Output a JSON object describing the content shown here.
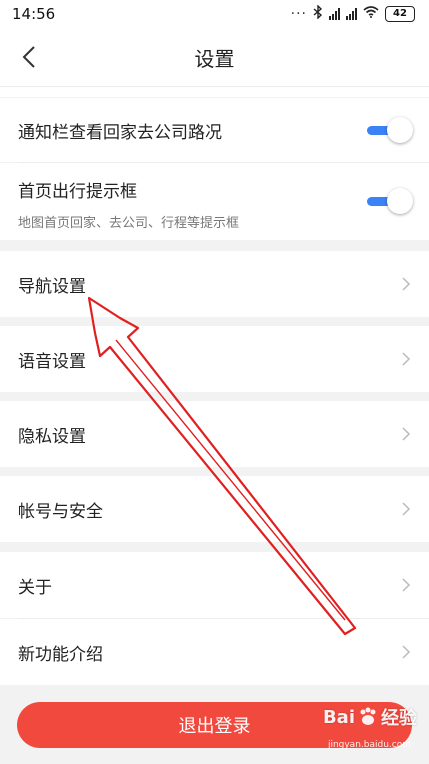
{
  "status_bar": {
    "time": "14:56",
    "dots": "···",
    "battery": "42"
  },
  "header": {
    "title": "设置"
  },
  "rows": {
    "notify_route": {
      "label": "通知栏查看回家去公司路况",
      "toggle_on": true
    },
    "home_prompt": {
      "label": "首页出行提示框",
      "sub": "地图首页回家、去公司、行程等提示框",
      "toggle_on": true
    },
    "navigation": {
      "label": "导航设置"
    },
    "voice": {
      "label": "语音设置"
    },
    "privacy": {
      "label": "隐私设置"
    },
    "account": {
      "label": "帐号与安全"
    },
    "about": {
      "label": "关于"
    },
    "new_features": {
      "label": "新功能介绍"
    }
  },
  "logout": {
    "label": "退出登录"
  },
  "watermark": {
    "brand": "Bai",
    "brand_suffix": "经验",
    "url": "jingyan.baidu.com"
  },
  "colors": {
    "accent_red": "#f2493e",
    "toggle_blue": "#3b82f6",
    "annotation_red": "#e02020"
  }
}
